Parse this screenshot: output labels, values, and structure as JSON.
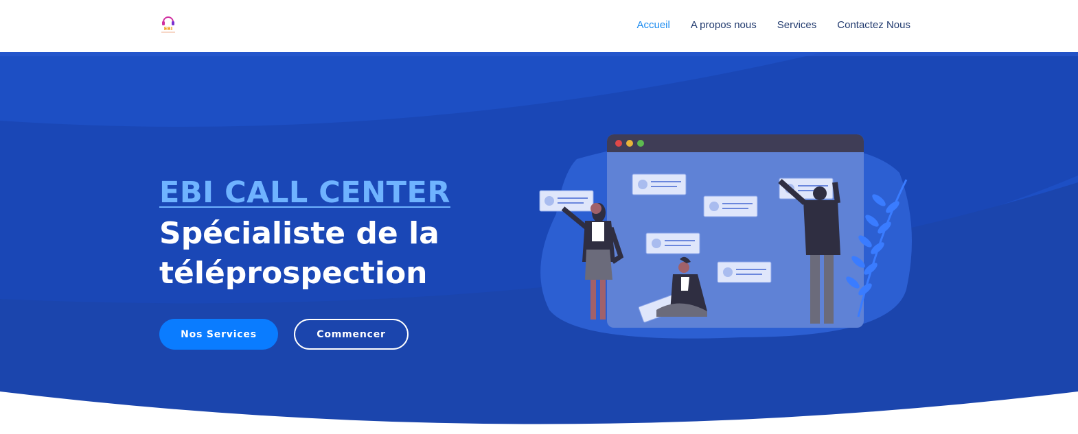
{
  "header": {
    "logo_text": "EBI",
    "nav": [
      {
        "label": "Accueil",
        "active": true
      },
      {
        "label": "A propos nous",
        "active": false
      },
      {
        "label": "Services",
        "active": false
      },
      {
        "label": "Contactez Nous",
        "active": false
      }
    ]
  },
  "hero": {
    "eyebrow": "EBI CALL CENTER",
    "headline": "Spécialiste de la téléprospection",
    "primary_button": "Nos Services",
    "secondary_button": "Commencer",
    "illustration_icon": "team-collaboration-illustration"
  },
  "colors": {
    "nav_active": "#1a8bf0",
    "nav_text": "#213a6e",
    "hero_bg": "#1d49b8",
    "eyebrow": "#6fb3ff",
    "primary_button": "#0a7cff"
  }
}
